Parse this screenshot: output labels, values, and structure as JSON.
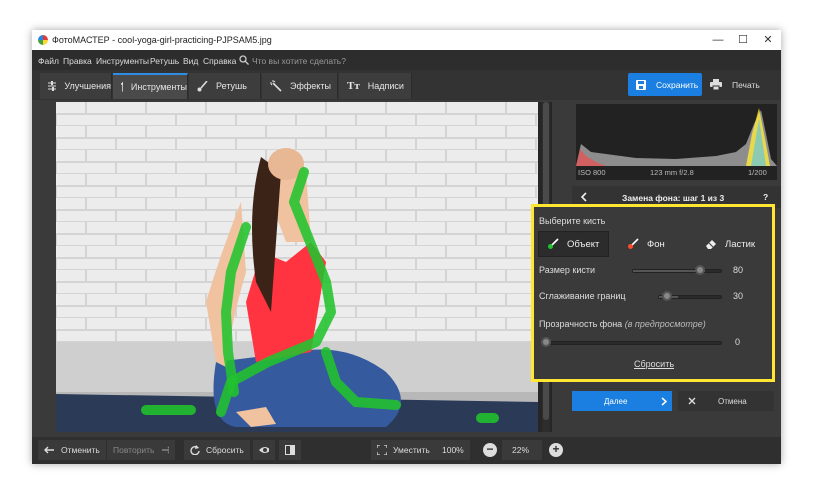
{
  "window": {
    "title": "ФотоМАСТЕР - cool-yoga-girl-practicing-PJPSAM5.jpg",
    "minimize": "—",
    "maximize": "☐",
    "close": "✕"
  },
  "menu": {
    "items": [
      "Файл",
      "Правка",
      "Инструменты",
      "Ретушь",
      "Вид",
      "Справка"
    ],
    "search_placeholder": "Что вы хотите сделать?"
  },
  "tabs": [
    {
      "label": "Улучшения",
      "icon": "sliders-icon"
    },
    {
      "label": "Инструменты",
      "icon": "crop-icon",
      "active": true
    },
    {
      "label": "Ретушь",
      "icon": "brush-icon"
    },
    {
      "label": "Эффекты",
      "icon": "magic-wand-icon"
    },
    {
      "label": "Надписи",
      "icon": "text-icon"
    }
  ],
  "toolbar": {
    "save_label": "Сохранить",
    "print_label": "Печать"
  },
  "histogram": {
    "iso": "ISO 800",
    "lens": "123 mm f/2.8",
    "shutter": "1/200"
  },
  "step": {
    "title": "Замена фона: шаг 1 из 3",
    "help": "?"
  },
  "brush_panel": {
    "heading": "Выберите кисть",
    "brushes": [
      {
        "label": "Объект",
        "selected": true
      },
      {
        "label": "Фон",
        "selected": false
      },
      {
        "label": "Ластик",
        "selected": false
      }
    ],
    "size_label": "Размер кисти",
    "size_value": "80",
    "size_fraction": 0.8,
    "smooth_label": "Сглаживание границ",
    "smooth_value": "30",
    "smooth_fraction": 0.3,
    "opacity_label": "Прозрачность фона",
    "opacity_hint": "(в предпросмотре)",
    "opacity_value": "0",
    "opacity_fraction": 0.0,
    "reset_label": "Сбросить"
  },
  "actions": {
    "next_label": "Далее",
    "cancel_label": "Отмена"
  },
  "bottom": {
    "undo": "Отменить",
    "redo": "Повторить",
    "reset": "Сбросить",
    "fit": "Уместить",
    "zoom_100": "100%",
    "zoom_value": "22%"
  },
  "colors": {
    "accent": "#1a7fe0",
    "highlight": "#ffe633",
    "brush_stroke": "#22c32e"
  }
}
